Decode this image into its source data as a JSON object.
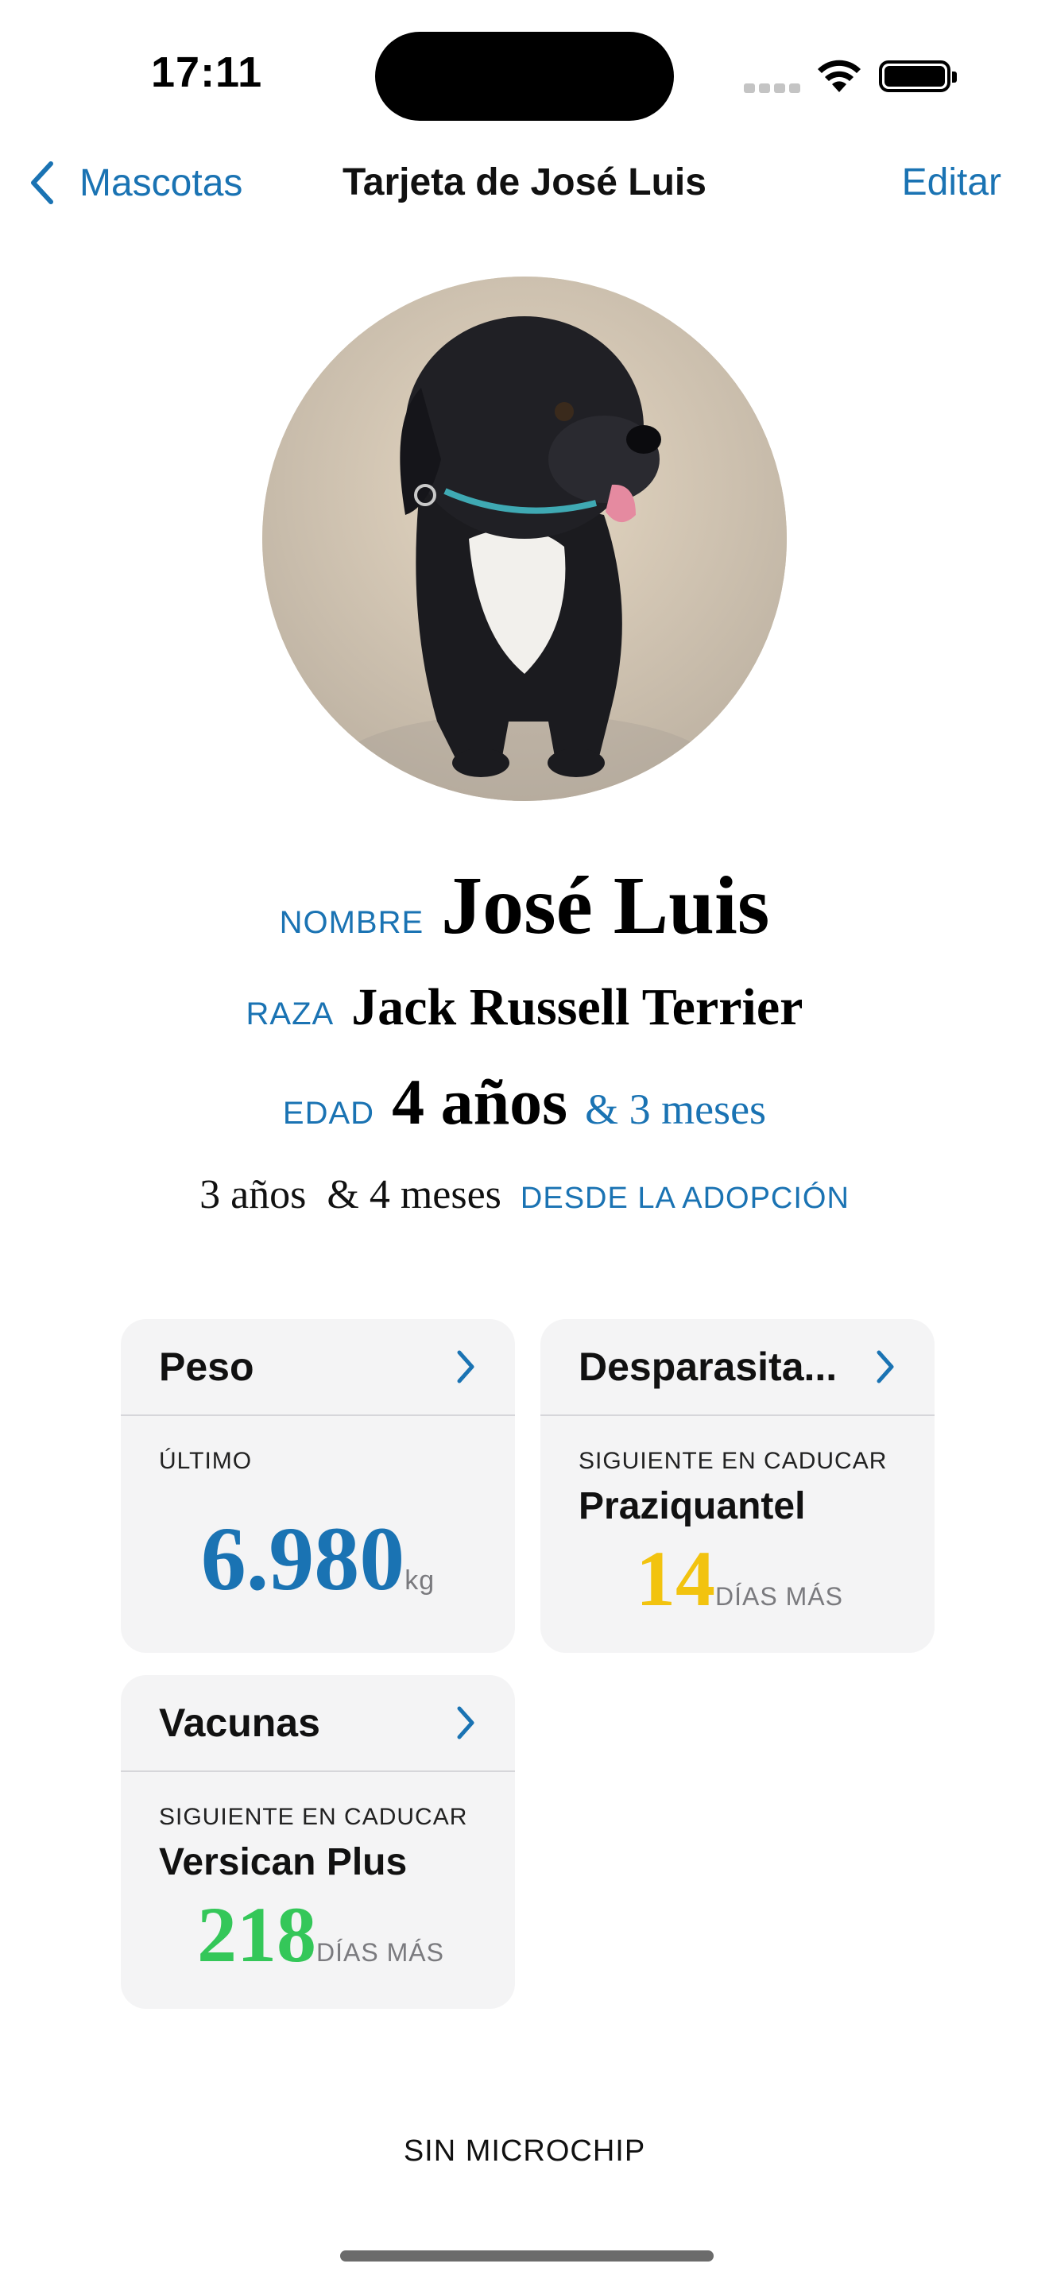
{
  "status": {
    "time": "17:11"
  },
  "nav": {
    "back_label": "Mascotas",
    "title": "Tarjeta de José Luis",
    "edit_label": "Editar"
  },
  "pet": {
    "name_label": "Nombre",
    "name": "José Luis",
    "breed_label": "Raza",
    "breed": "Jack Russell Terrier",
    "age_label": "Edad",
    "age_years": "4 años",
    "age_months": "& 3 meses",
    "adoption_value": "3 años  & 4 meses",
    "adoption_label": "DESDE LA ADOPCIÓN"
  },
  "cards": {
    "peso": {
      "title": "Peso",
      "caption": "ÚLTIMO",
      "value": "6.980",
      "unit": "kg"
    },
    "desparasitacion": {
      "title": "Desparasita...",
      "caption": "SIGUIENTE EN CADUCAR",
      "product": "Praziquantel",
      "days": "14",
      "days_label": "DÍAS MÁS",
      "days_color": "#f2c30f"
    },
    "vacunas": {
      "title": "Vacunas",
      "caption": "SIGUIENTE EN CADUCAR",
      "product": "Versican Plus",
      "days": "218",
      "days_label": "DÍAS MÁS",
      "days_color": "#34c759"
    }
  },
  "footer": {
    "microchip": "SIN MICROCHIP"
  },
  "colors": {
    "accent": "#1a73b3"
  }
}
